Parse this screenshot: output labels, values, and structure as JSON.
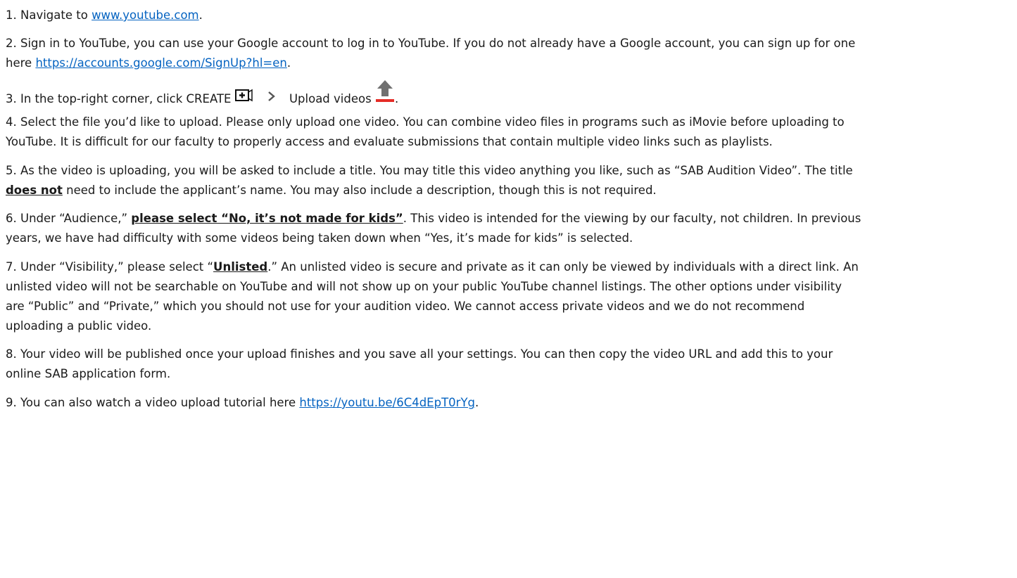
{
  "steps": {
    "s1": {
      "prefix": "1. Navigate to ",
      "link": "www.youtube.com",
      "suffix": "."
    },
    "s2": {
      "line1": "2. Sign in to YouTube, you can use your Google account to log in to YouTube. If you do not already have a Google account, you can sign up for one",
      "prefix2": "here ",
      "link": "https://accounts.google.com/SignUp?hl=en",
      "suffix": "."
    },
    "s3": {
      "prefix": "3. In the top-right corner, click CREATE ",
      "middle": " Upload videos ",
      "suffix": "."
    },
    "s4": {
      "line1": "4. Select the file you’d like to upload. Please only upload one video. You can combine video files in programs such as iMovie before uploading to",
      "line2": "YouTube. It is difficult for our faculty to properly access and evaluate submissions that contain multiple video links such as playlists."
    },
    "s5": {
      "line1": "5. As the video is uploading, you will be asked to include a title. You may title this video anything you like, such as “SAB Audition Video”. The title",
      "bold": "does not",
      "line2": " need to include the applicant’s name. You may also include a description, though this is not required."
    },
    "s6": {
      "prefix": "6. Under “Audience,” ",
      "bold": "please select “No, it’s not made for kids”",
      "suffix": ". This video is intended for the viewing by our faculty, not children. In previous",
      "line2": "years, we have had difficulty with some videos being taken down when “Yes, it’s made for kids” is selected."
    },
    "s7": {
      "prefix": "7. Under “Visibility,” please select “",
      "bold": "Unlisted",
      "suffix": ".” An unlisted video is secure and private as it can only be viewed by individuals with a direct link. An",
      "line2": "unlisted video will not be searchable on YouTube and will not show up on your public YouTube channel listings. The other options under visibility",
      "line3": "are “Public” and “Private,” which you should not use for your audition video. We cannot access private videos and we do not recommend",
      "line4": "uploading a public video."
    },
    "s8": {
      "line1": "8. Your video will be published once your upload finishes and you save all your settings. You can then copy the video URL and add this to your",
      "line2": "online SAB application form."
    },
    "s9": {
      "prefix": "9. You can also watch a video upload tutorial here ",
      "link": "https://youtu.be/6C4dEpT0rYg",
      "suffix": "."
    }
  },
  "icons": [
    "create-video-icon",
    "chevron-right-icon",
    "upload-icon"
  ],
  "colors": {
    "link": "#0563c1",
    "upload_arrow": "#707070",
    "upload_bar": "#e52d27"
  }
}
